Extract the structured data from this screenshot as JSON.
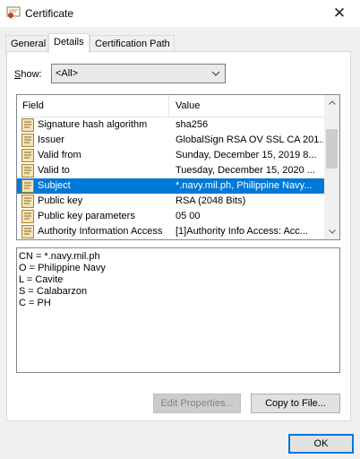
{
  "window": {
    "title": "Certificate",
    "close_glyph": "✕"
  },
  "tabs": [
    {
      "label": "General"
    },
    {
      "label": "Details"
    },
    {
      "label": "Certification Path"
    }
  ],
  "show": {
    "label_prefix": "S",
    "label_rest": "how:",
    "value": "<All>",
    "chevron": "⌄"
  },
  "listview": {
    "columns": [
      "Field",
      "Value"
    ],
    "rows": [
      {
        "field": "Signature hash algorithm",
        "value": "sha256"
      },
      {
        "field": "Issuer",
        "value": "GlobalSign RSA OV SSL CA 201..."
      },
      {
        "field": "Valid from",
        "value": "Sunday, December 15, 2019 8..."
      },
      {
        "field": "Valid to",
        "value": "Tuesday, December 15, 2020 ..."
      },
      {
        "field": "Subject",
        "value": "*.navy.mil.ph, Philippine Navy..."
      },
      {
        "field": "Public key",
        "value": "RSA (2048 Bits)"
      },
      {
        "field": "Public key parameters",
        "value": "05 00"
      },
      {
        "field": "Authority Information Access",
        "value": "[1]Authority Info Access: Acc..."
      }
    ],
    "selected_index": 4
  },
  "detail_lines": [
    "CN = *.navy.mil.ph",
    "O = Philippine Navy",
    "L = Cavite",
    "S = Calabarzon",
    "C = PH"
  ],
  "buttons": {
    "edit_properties": "Edit Properties...",
    "copy_to_file": "Copy to File...",
    "ok": "OK"
  },
  "colors": {
    "selection": "#0078d7",
    "dialog_bg": "#f0f0f0"
  }
}
